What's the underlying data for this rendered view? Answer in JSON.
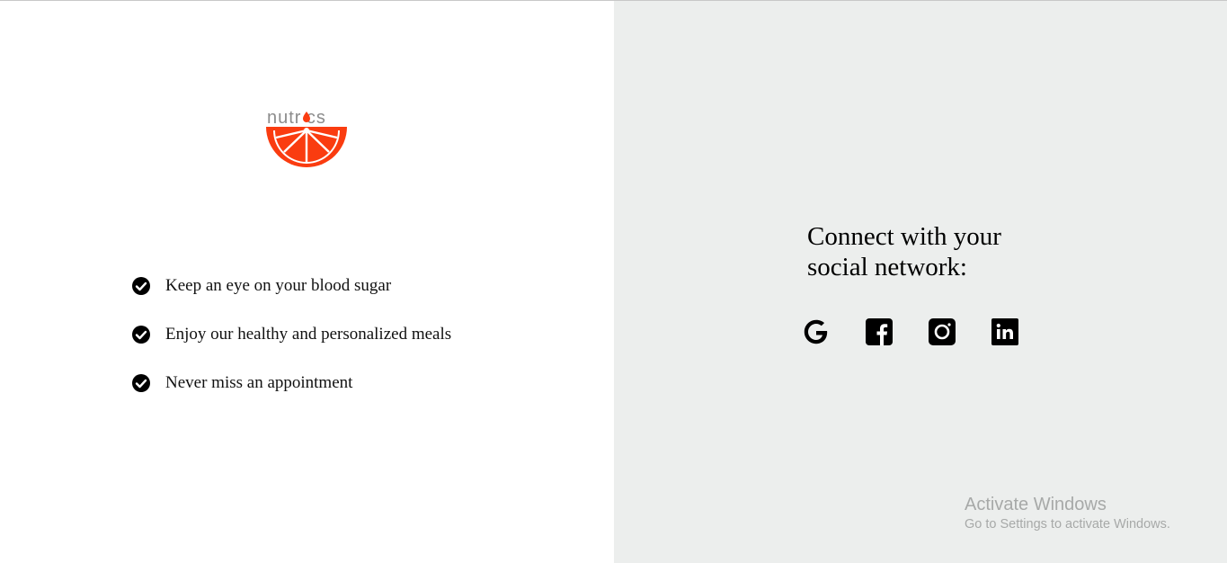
{
  "brand": {
    "logo_text": "nutrics",
    "accent_color": "#fa3c10",
    "logo_text_color": "#8c8c8c"
  },
  "features": [
    {
      "label": "Keep an eye on your blood sugar",
      "icon": "check-circle-icon"
    },
    {
      "label": "Enjoy our healthy and personalized meals",
      "icon": "check-circle-icon"
    },
    {
      "label": "Never miss an appointment",
      "icon": "check-circle-icon"
    }
  ],
  "connect": {
    "title": "Connect with your social network:",
    "socials": [
      {
        "name": "Google",
        "icon": "google-icon"
      },
      {
        "name": "Facebook",
        "icon": "facebook-icon"
      },
      {
        "name": "Instagram",
        "icon": "instagram-icon"
      },
      {
        "name": "LinkedIn",
        "icon": "linkedin-icon"
      }
    ]
  },
  "watermark": {
    "title": "Activate Windows",
    "subtitle": "Go to Settings to activate Windows."
  },
  "colors": {
    "left_bg": "#ffffff",
    "right_bg": "#eceeed"
  }
}
